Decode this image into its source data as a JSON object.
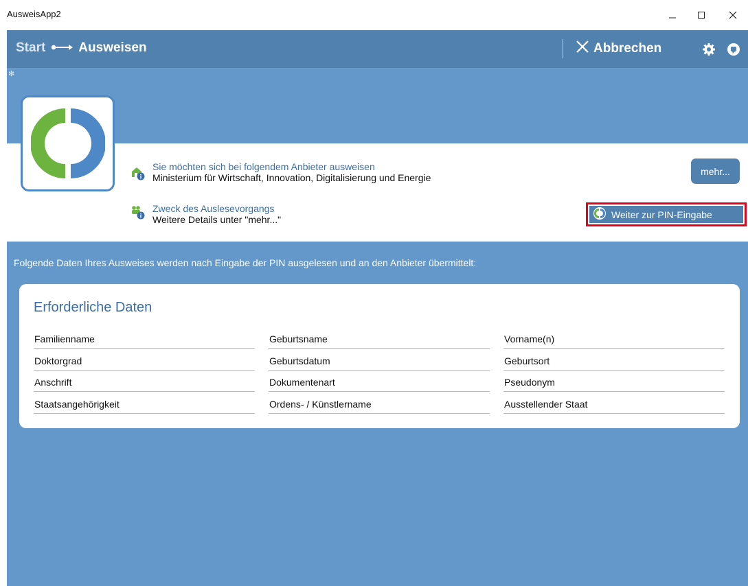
{
  "window": {
    "title": "AusweisApp2"
  },
  "header": {
    "breadcrumb_start": "Start",
    "breadcrumb_current": "Ausweisen",
    "cancel_label": "Abbrechen"
  },
  "provider": {
    "title": "Sie möchten sich bei folgendem Anbieter ausweisen",
    "name": "Ministerium für Wirtschaft, Innovation, Digitalisierung und Energie",
    "more_label": "mehr..."
  },
  "purpose": {
    "title": "Zweck des Auslesevorgangs",
    "detail": "Weitere Details unter \"mehr...\""
  },
  "pin_button_label": "Weiter zur PIN-Eingabe",
  "lead_text": "Folgende Daten Ihres Ausweises werden nach Eingabe der PIN ausgelesen und an den Anbieter übermittelt:",
  "required": {
    "title": "Erforderliche Daten",
    "fields": [
      "Familienname",
      "Geburtsname",
      "Vorname(n)",
      "Doktorgrad",
      "Geburtsdatum",
      "Geburtsort",
      "Anschrift",
      "Dokumentenart",
      "Pseudonym",
      "Staatsangehörigkeit",
      "Ordens- / Künstlername",
      "Ausstellender Staat"
    ]
  },
  "colors": {
    "accent": "#5181ae",
    "background": "#6497ca",
    "highlight": "#e3001b"
  },
  "icons": [
    "minimize-icon",
    "maximize-icon",
    "close-icon",
    "arrow-right-icon",
    "x-icon",
    "settings-icon",
    "help-icon",
    "app-logo",
    "provider-info-icon",
    "purpose-info-icon",
    "app-logo-small-icon"
  ]
}
